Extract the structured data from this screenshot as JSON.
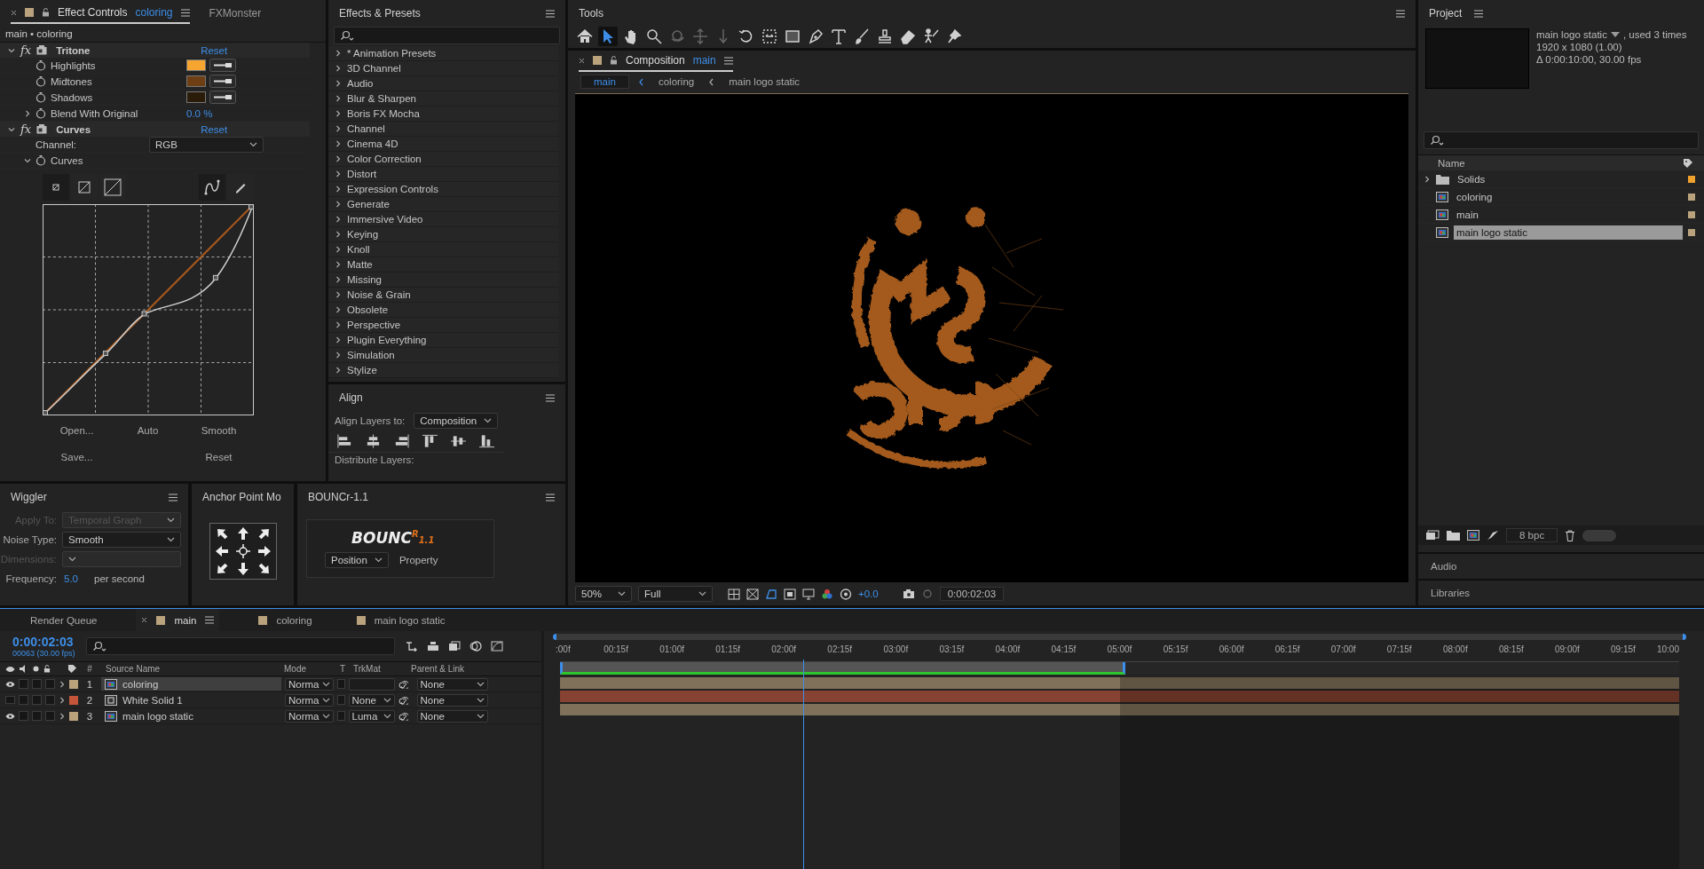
{
  "effect_controls": {
    "tabs": [
      {
        "label": "Effect Controls",
        "layer": "coloring",
        "selected": true
      },
      {
        "label": "FXMonster",
        "selected": false
      }
    ],
    "path": "main • coloring",
    "effects": [
      {
        "badge": "fx",
        "name": "Tritone",
        "reset": "Reset",
        "expanded": true,
        "params": [
          {
            "kind": "color",
            "label": "Highlights",
            "color": "#f7a531"
          },
          {
            "kind": "color",
            "label": "Midtones",
            "color": "#6e3f14"
          },
          {
            "kind": "color",
            "label": "Shadows",
            "color": "#2b1b09"
          },
          {
            "kind": "value",
            "label": "Blend With Original",
            "value": "0.0 %",
            "expanded": false
          }
        ]
      },
      {
        "badge": "fx",
        "name": "Curves",
        "reset": "Reset",
        "expanded": true,
        "params": [
          {
            "kind": "dropdown",
            "label": "Channel:",
            "value": "RGB"
          },
          {
            "kind": "curves",
            "label": "Curves",
            "expanded": true,
            "buttons": [
              "Open...",
              "Auto",
              "Smooth",
              "Save...",
              "Reset"
            ]
          }
        ]
      }
    ]
  },
  "effects_presets": {
    "title": "Effects & Presets",
    "categories": [
      "* Animation Presets",
      "3D Channel",
      "Audio",
      "Blur & Sharpen",
      "Boris FX Mocha",
      "Channel",
      "Cinema 4D",
      "Color Correction",
      "Distort",
      "Expression Controls",
      "Generate",
      "Immersive Video",
      "Keying",
      "Knoll",
      "Matte",
      "Missing",
      "Noise & Grain",
      "Obsolete",
      "Perspective",
      "Plugin Everything",
      "Simulation",
      "Stylize"
    ]
  },
  "align": {
    "title": "Align",
    "align_to_label": "Align Layers to:",
    "align_to": "Composition",
    "distribute_label": "Distribute Layers:"
  },
  "tools": {
    "title": "Tools",
    "items": [
      {
        "kind": "home",
        "selected": false,
        "disabled": false
      },
      {
        "kind": "selection",
        "selected": true,
        "disabled": false
      },
      {
        "kind": "hand",
        "selected": false,
        "disabled": false
      },
      {
        "kind": "zoom",
        "selected": false,
        "disabled": false
      },
      {
        "kind": "orbit",
        "selected": false,
        "disabled": true
      },
      {
        "kind": "pan",
        "selected": false,
        "disabled": true
      },
      {
        "kind": "dolly",
        "selected": false,
        "disabled": true
      },
      {
        "kind": "rotate",
        "selected": false,
        "disabled": false
      },
      {
        "kind": "pan_behind",
        "selected": false,
        "disabled": false
      },
      {
        "kind": "rectangle",
        "selected": false,
        "disabled": false
      },
      {
        "kind": "pen",
        "selected": false,
        "disabled": false
      },
      {
        "kind": "type",
        "selected": false,
        "disabled": false
      },
      {
        "kind": "brush",
        "selected": false,
        "disabled": false
      },
      {
        "kind": "stamp",
        "selected": false,
        "disabled": false
      },
      {
        "kind": "eraser",
        "selected": false,
        "disabled": false
      },
      {
        "kind": "roto",
        "selected": false,
        "disabled": false
      },
      {
        "kind": "puppet",
        "selected": false,
        "disabled": false
      }
    ]
  },
  "composition": {
    "tab": "Composition",
    "name": "main",
    "breadcrumbs": [
      {
        "label": "main",
        "selected": true
      },
      {
        "label": "coloring",
        "selected": false
      },
      {
        "label": "main logo static",
        "selected": false
      }
    ],
    "zoom": "50%",
    "resolution": "Full",
    "exposure": "+0.0",
    "timecode": "0:00:02:03"
  },
  "project": {
    "title": "Project",
    "preview": {
      "name": "main logo static",
      "usage": ", used 3 times",
      "size": "1920 x 1080 (1.00)",
      "duration": "Δ 0:00:10:00, 30.00 fps"
    },
    "column": "Name",
    "items": [
      {
        "kind": "folder",
        "name": "Solids",
        "color": "#f0a02c",
        "selected": false
      },
      {
        "kind": "comp",
        "name": "coloring",
        "color": "#b9a27c",
        "selected": false
      },
      {
        "kind": "comp",
        "name": "main",
        "color": "#b9a27c",
        "selected": false
      },
      {
        "kind": "comp",
        "name": "main logo static",
        "color": "#b9a27c",
        "selected": true
      }
    ],
    "bpc": "8 bpc"
  },
  "side_panels": [
    "Audio",
    "Libraries"
  ],
  "wiggler": {
    "title": "Wiggler",
    "fields": [
      {
        "label": "Apply To:",
        "value": "Temporal Graph",
        "disabled": true
      },
      {
        "label": "Noise Type:",
        "value": "Smooth",
        "disabled": false
      },
      {
        "label": "Dimensions:",
        "disabled": true
      }
    ],
    "frequency_label": "Frequency:",
    "frequency": "5.0",
    "frequency_unit": "per second"
  },
  "anchor_point": {
    "title": "Anchor Point Mo"
  },
  "bouncr": {
    "title": "BOUNCr-1.1",
    "logo": "BOUNC",
    "logo_sup": "R",
    "logo_version": "1.1",
    "property": "Position",
    "property_label": "Property"
  },
  "timeline": {
    "tabs": [
      {
        "label": "Render Queue",
        "kind": "queue",
        "selected": false
      },
      {
        "label": "main",
        "kind": "comp",
        "selected": true
      },
      {
        "label": "coloring",
        "kind": "comp",
        "selected": false
      },
      {
        "label": "main logo static",
        "kind": "comp",
        "selected": false
      }
    ],
    "timecode": "0:00:02:03",
    "frames": "00063 (30.00 fps)",
    "columns": {
      "number": "#",
      "source": "Source Name",
      "mode": "Mode",
      "t": "T",
      "trkmat": "TrkMat",
      "parent": "Parent & Link"
    },
    "layers": [
      {
        "number": "1",
        "name": "coloring",
        "kind": "comp",
        "color": "#b9a27c",
        "visible": true,
        "selected": true,
        "mode": "Norma",
        "parent": "None"
      },
      {
        "number": "2",
        "name": "White Solid 1",
        "kind": "solid",
        "color": "#c4553b",
        "visible": false,
        "selected": false,
        "mode": "Norma",
        "trkmat": "None",
        "parent": "None"
      },
      {
        "number": "3",
        "name": "main logo static",
        "kind": "comp",
        "color": "#b9a27c",
        "visible": true,
        "selected": false,
        "mode": "Norma",
        "trkmat": "Luma",
        "parent": "None"
      }
    ],
    "ruler": [
      ":00f",
      "00:15f",
      "01:00f",
      "01:15f",
      "02:00f",
      "02:15f",
      "03:00f",
      "03:15f",
      "04:00f",
      "04:15f",
      "05:00f",
      "05:15f",
      "06:00f",
      "06:15f",
      "07:00f",
      "07:15f",
      "08:00f",
      "08:15f",
      "09:00f",
      "09:15f",
      "10:00"
    ],
    "playhead": {
      "level": 0.21
    },
    "work_area": {
      "level": 0.5
    }
  }
}
